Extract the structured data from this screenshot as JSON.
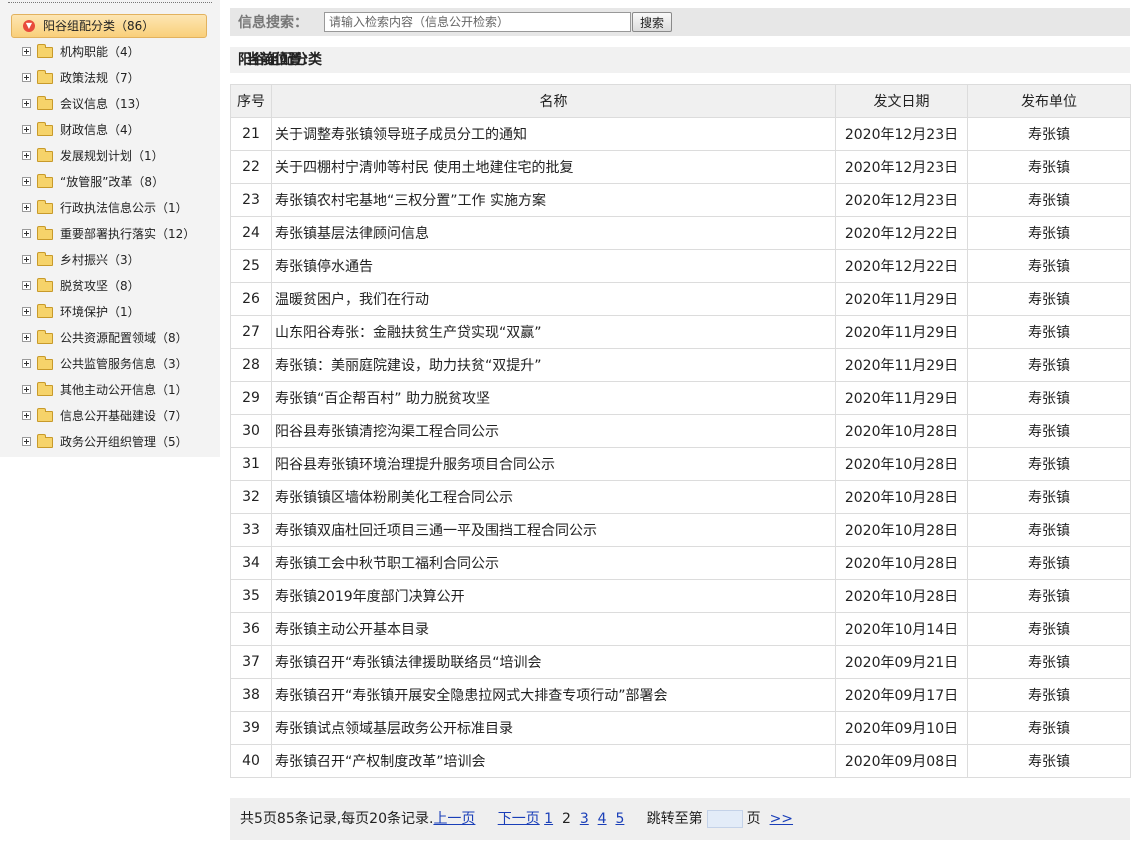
{
  "sidebar": {
    "root": "阳谷组配分类（86）",
    "items": [
      {
        "label": "机构职能（4）"
      },
      {
        "label": "政策法规（7）"
      },
      {
        "label": "会议信息（13）"
      },
      {
        "label": "财政信息（4）"
      },
      {
        "label": "发展规划计划（1）"
      },
      {
        "label": "“放管服”改革（8）"
      },
      {
        "label": "行政执法信息公示（1）"
      },
      {
        "label": "重要部署执行落实（12）"
      },
      {
        "label": "乡村振兴（3）"
      },
      {
        "label": "脱贫攻坚（8）"
      },
      {
        "label": "环境保护（1）"
      },
      {
        "label": "公共资源配置领域（8）"
      },
      {
        "label": "公共监管服务信息（3）"
      },
      {
        "label": "其他主动公开信息（1）"
      },
      {
        "label": "信息公开基础建设（7）"
      },
      {
        "label": "政务公开组织管理（5）"
      }
    ]
  },
  "search": {
    "label": "信息搜索：",
    "placeholder": "请输入检索内容（信息公开检索）",
    "button": "搜索"
  },
  "location": {
    "prefix": "当前位置：",
    "value": "阳谷组配分类"
  },
  "table": {
    "headers": {
      "no": "序号",
      "title": "名称",
      "date": "发文日期",
      "unit": "发布单位"
    },
    "rows": [
      {
        "no": "21",
        "title": "关于调整寿张镇领导班子成员分工的通知",
        "date": "2020年12月23日",
        "unit": "寿张镇"
      },
      {
        "no": "22",
        "title": "关于四棚村宁清帅等村民 使用土地建住宅的批复",
        "date": "2020年12月23日",
        "unit": "寿张镇"
      },
      {
        "no": "23",
        "title": "寿张镇农村宅基地“三权分置”工作 实施方案",
        "date": "2020年12月23日",
        "unit": "寿张镇"
      },
      {
        "no": "24",
        "title": "寿张镇基层法律顾问信息",
        "date": "2020年12月22日",
        "unit": "寿张镇"
      },
      {
        "no": "25",
        "title": "寿张镇停水通告",
        "date": "2020年12月22日",
        "unit": "寿张镇"
      },
      {
        "no": "26",
        "title": "温暖贫困户，我们在行动",
        "date": "2020年11月29日",
        "unit": "寿张镇"
      },
      {
        "no": "27",
        "title": "山东阳谷寿张：金融扶贫生产贷实现“双赢”",
        "date": "2020年11月29日",
        "unit": "寿张镇"
      },
      {
        "no": "28",
        "title": "寿张镇：美丽庭院建设，助力扶贫“双提升”",
        "date": "2020年11月29日",
        "unit": "寿张镇"
      },
      {
        "no": "29",
        "title": "寿张镇“百企帮百村” 助力脱贫攻坚",
        "date": "2020年11月29日",
        "unit": "寿张镇"
      },
      {
        "no": "30",
        "title": "阳谷县寿张镇清挖沟渠工程合同公示",
        "date": "2020年10月28日",
        "unit": "寿张镇"
      },
      {
        "no": "31",
        "title": "阳谷县寿张镇环境治理提升服务项目合同公示",
        "date": "2020年10月28日",
        "unit": "寿张镇"
      },
      {
        "no": "32",
        "title": "寿张镇镇区墙体粉刷美化工程合同公示",
        "date": "2020年10月28日",
        "unit": "寿张镇"
      },
      {
        "no": "33",
        "title": "寿张镇双庙杜回迁项目三通一平及围挡工程合同公示",
        "date": "2020年10月28日",
        "unit": "寿张镇"
      },
      {
        "no": "34",
        "title": "寿张镇工会中秋节职工福利合同公示",
        "date": "2020年10月28日",
        "unit": "寿张镇"
      },
      {
        "no": "35",
        "title": "寿张镇2019年度部门决算公开",
        "date": "2020年10月28日",
        "unit": "寿张镇"
      },
      {
        "no": "36",
        "title": "寿张镇主动公开基本目录",
        "date": "2020年10月14日",
        "unit": "寿张镇"
      },
      {
        "no": "37",
        "title": "寿张镇召开“寿张镇法律援助联络员“培训会",
        "date": "2020年09月21日",
        "unit": "寿张镇"
      },
      {
        "no": "38",
        "title": "寿张镇召开“寿张镇开展安全隐患拉网式大排查专项行动”部署会",
        "date": "2020年09月17日",
        "unit": "寿张镇"
      },
      {
        "no": "39",
        "title": "寿张镇试点领域基层政务公开标准目录",
        "date": "2020年09月10日",
        "unit": "寿张镇"
      },
      {
        "no": "40",
        "title": "寿张镇召开“产权制度改革”培训会",
        "date": "2020年09月08日",
        "unit": "寿张镇"
      }
    ]
  },
  "pager": {
    "summary": "共5页85条记录,每页20条记录.",
    "prev": "上一页",
    "next": "下一页",
    "pages": [
      "1",
      "2",
      "3",
      "4",
      "5"
    ],
    "current": "2",
    "jump_prefix": "跳转至第",
    "jump_suffix": "页",
    "go": ">>"
  }
}
